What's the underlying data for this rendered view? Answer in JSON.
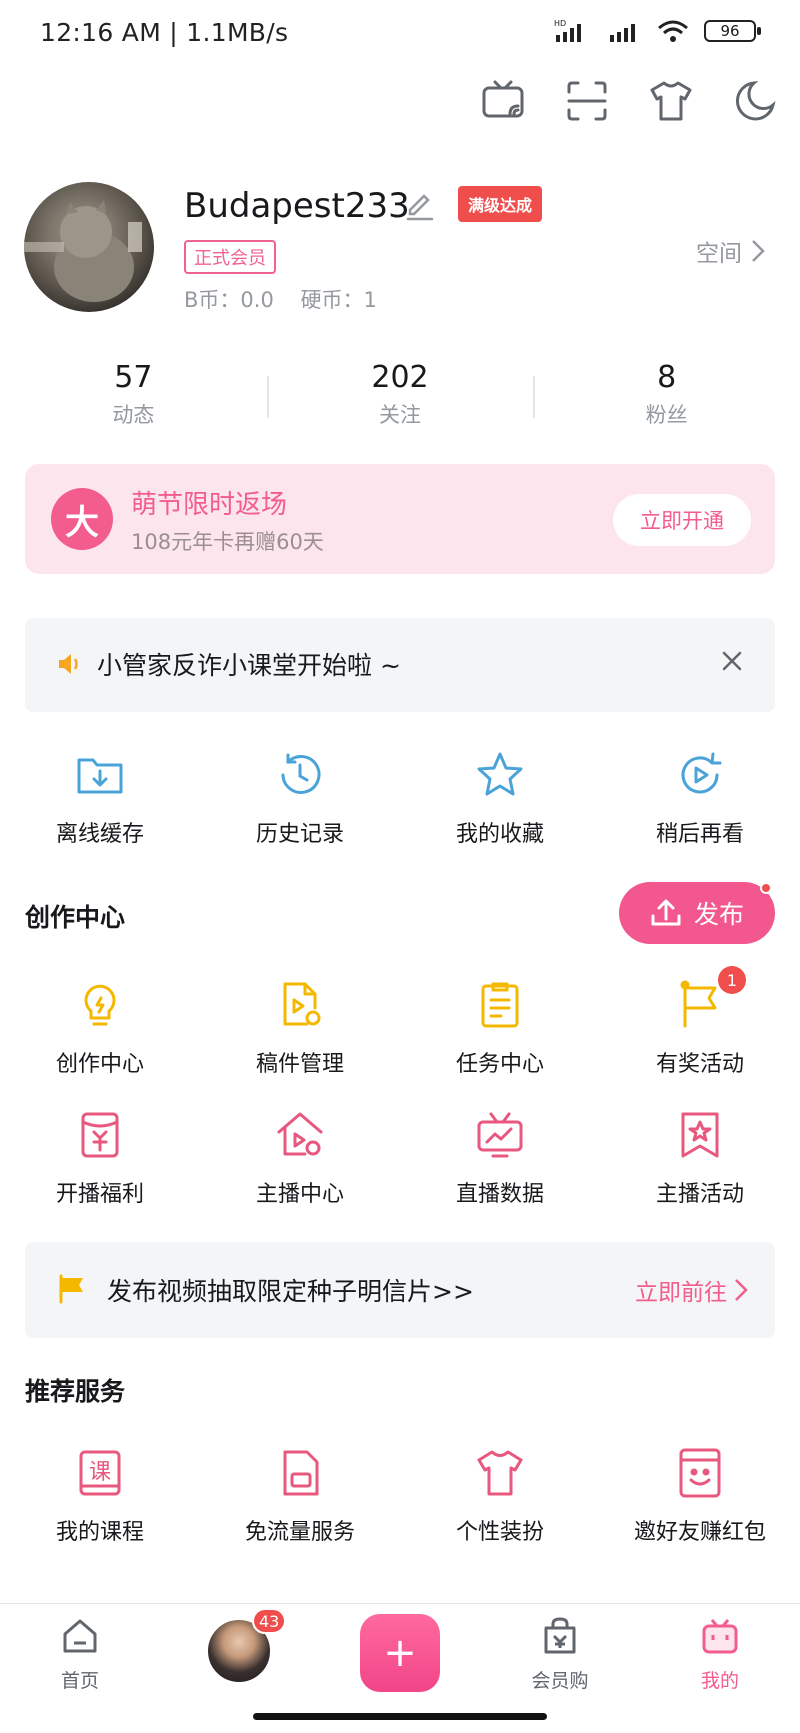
{
  "status_bar": {
    "time": "12:16 AM | 1.1MB/s",
    "battery": "96",
    "network": "HD"
  },
  "top_actions": [
    "tv-cast-icon",
    "scan-icon",
    "tshirt-icon",
    "moon-icon"
  ],
  "profile": {
    "username": "Budapest233",
    "level_badge": "满级达成",
    "vip_tag": "正式会员",
    "coins": "B币：0.0    硬币：1",
    "space_link": "空间"
  },
  "stats": [
    {
      "value": "57",
      "label": "动态"
    },
    {
      "value": "202",
      "label": "关注"
    },
    {
      "value": "8",
      "label": "粉丝"
    }
  ],
  "vip_banner": {
    "logo": "大",
    "title": "萌节限时返场",
    "subtitle": "108元年卡再赠60天",
    "button": "立即开通"
  },
  "notice": {
    "text": "小管家反诈小课堂开始啦 ~"
  },
  "quick_items": [
    {
      "label": "离线缓存",
      "icon": "download-folder-icon"
    },
    {
      "label": "历史记录",
      "icon": "history-icon"
    },
    {
      "label": "我的收藏",
      "icon": "star-icon"
    },
    {
      "label": "稍后再看",
      "icon": "watch-later-icon"
    }
  ],
  "creator": {
    "title": "创作中心",
    "publish_label": "发布",
    "row1": [
      {
        "label": "创作中心",
        "icon": "lightbulb-icon"
      },
      {
        "label": "稿件管理",
        "icon": "manuscript-icon"
      },
      {
        "label": "任务中心",
        "icon": "clipboard-icon"
      },
      {
        "label": "有奖活动",
        "icon": "flag-icon",
        "badge": "1"
      }
    ],
    "row2": [
      {
        "label": "开播福利",
        "icon": "red-envelope-icon"
      },
      {
        "label": "主播中心",
        "icon": "streamer-home-icon"
      },
      {
        "label": "直播数据",
        "icon": "live-data-icon"
      },
      {
        "label": "主播活动",
        "icon": "bookmark-star-icon"
      }
    ]
  },
  "promo": {
    "text": "发布视频抽取限定种子明信片>>",
    "link": "立即前往"
  },
  "services": {
    "title": "推荐服务",
    "items": [
      {
        "label": "我的课程",
        "icon": "course-icon"
      },
      {
        "label": "免流量服务",
        "icon": "sim-card-icon"
      },
      {
        "label": "个性装扮",
        "icon": "outfit-icon"
      },
      {
        "label": "邀好友赚红包",
        "icon": "invite-envelope-icon"
      }
    ]
  },
  "bottom_nav": {
    "home": "首页",
    "avatar_badge": "43",
    "plus": "+",
    "vip_shop": "会员购",
    "mine": "我的"
  },
  "colors": {
    "accent": "#f25d8e",
    "blue": "#4aa3d8",
    "yellow": "#f5b800",
    "badge_red": "#f04d4d"
  }
}
